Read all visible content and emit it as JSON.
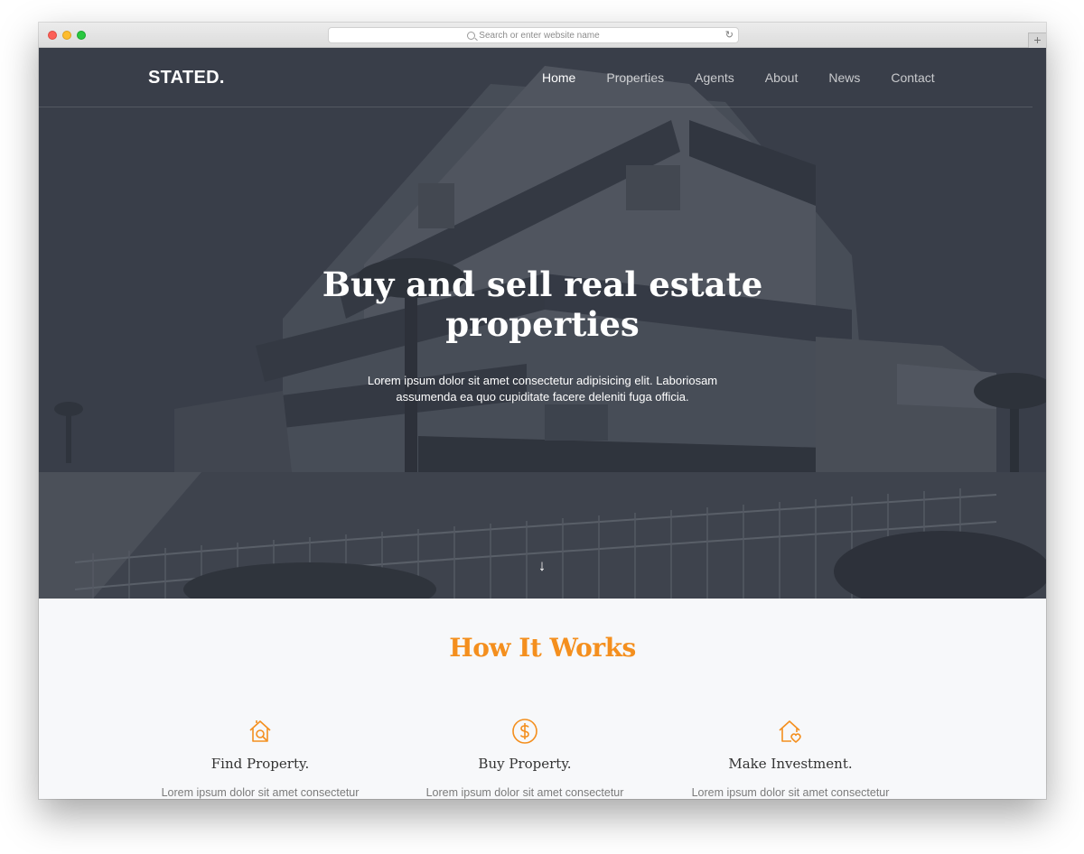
{
  "browser": {
    "url_placeholder": "Search or enter website name",
    "newtab_label": "+"
  },
  "nav": {
    "logo": "STATED.",
    "items": [
      {
        "label": "Home",
        "active": true
      },
      {
        "label": "Properties",
        "active": false
      },
      {
        "label": "Agents",
        "active": false
      },
      {
        "label": "About",
        "active": false
      },
      {
        "label": "News",
        "active": false
      },
      {
        "label": "Contact",
        "active": false
      }
    ]
  },
  "hero": {
    "title_line1": "Buy and sell real estate",
    "title_line2": "properties",
    "subtitle_line1": "Lorem ipsum dolor sit amet consectetur adipisicing elit. Laboriosam",
    "subtitle_line2": "assumenda ea quo cupiditate facere deleniti fuga officia.",
    "scroll_icon": "arrow-down-icon"
  },
  "how_it_works": {
    "title": "How It Works",
    "accent_color": "#f48f1e",
    "steps": [
      {
        "icon": "house-search-icon",
        "title": "Find Property.",
        "text": "Lorem ipsum dolor sit amet consectetur"
      },
      {
        "icon": "dollar-coin-icon",
        "title": "Buy Property.",
        "text": "Lorem ipsum dolor sit amet consectetur"
      },
      {
        "icon": "house-heart-icon",
        "title": "Make Investment.",
        "text": "Lorem ipsum dolor sit amet consectetur"
      }
    ]
  }
}
